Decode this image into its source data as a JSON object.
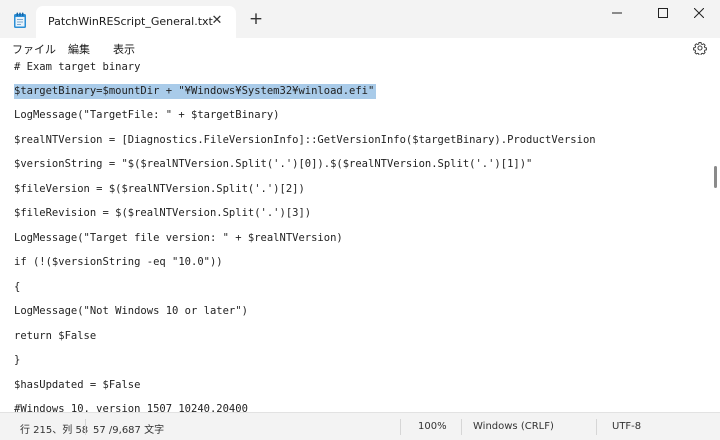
{
  "window": {
    "tab_title": "PatchWinREScript_General.txt",
    "tab_close_glyph": "✕",
    "new_tab_glyph": "+",
    "icons": {
      "app": "notepad-icon",
      "minimize": "minimize-icon",
      "maximize": "maximize-icon",
      "close": "close-icon"
    }
  },
  "menu": {
    "file": "ファイル",
    "edit": "編集",
    "view": "表示",
    "settings_icon": "gear-icon"
  },
  "editor": {
    "selection_color": "#a9cbe9",
    "lines": [
      "# Exam target binary",
      "$targetBinary=$mountDir + \"¥Windows¥System32¥winload.efi\"",
      "LogMessage(\"TargetFile: \" + $targetBinary)",
      "$realNTVersion = [Diagnostics.FileVersionInfo]::GetVersionInfo($targetBinary).ProductVersion",
      "$versionString = \"$($realNTVersion.Split('.')[0]).$($realNTVersion.Split('.')[1])\"",
      "$fileVersion = $($realNTVersion.Split('.')[2])",
      "$fileRevision = $($realNTVersion.Split('.')[3])",
      "LogMessage(\"Target file version: \" + $realNTVersion)",
      "if (!($versionString -eq \"10.0\"))",
      "{",
      "LogMessage(\"Not Windows 10 or later\")",
      "return $False",
      "}",
      "$hasUpdated = $False",
      "#Windows 10, version 1507 10240.20400"
    ]
  },
  "status": {
    "position": "行 215、列 58",
    "char_count": "57 /9,687 文字",
    "zoom": "100%",
    "line_ending": "Windows (CRLF)",
    "encoding": "UTF-8"
  }
}
